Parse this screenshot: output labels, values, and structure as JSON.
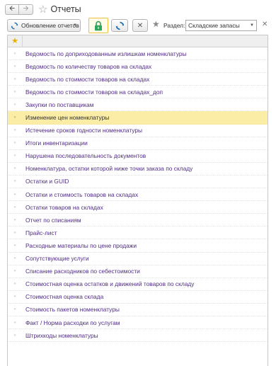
{
  "window": {
    "title": "Отчеты",
    "back_icon": "arrow-left",
    "forward_icon": "arrow-right"
  },
  "toolbar": {
    "refresh_label": "Обновление отчетов",
    "section_label": "Раздел:",
    "section_value": "Складские запасы"
  },
  "colors": {
    "link": "#502d86",
    "selected_row": "#fbeca6",
    "favorite_star": "#e7b100"
  },
  "reports": [
    "Ведомость по доприходованным излишкам номенклатуры",
    "Ведомость по количеству товаров на складах",
    "Ведомость по стоимости товаров на складах",
    "Ведомость по стоимости товаров на складах_доп",
    "Закупки по поставщикам",
    "Изменение цен номенклатуры",
    "Истечение сроков годности номенклатуры",
    "Итоги инвентаризации",
    "Нарушена последовательность документов",
    "Номенклатура, остатки которой ниже точки заказа по складу",
    "Остатки и GUID",
    "Остатки и стоимость товаров на складах",
    "Остатки товаров на складах",
    "Отчет по списаниям",
    "Прайс-лист",
    "Расходные материалы по цене продажи",
    "Сопутствующие услуги",
    "Списание расходников по себестоимости",
    "Стоимостная оценка остатков и движений товаров по складу",
    "Стоимостная оценка склада",
    "Стоимость пакетов номенклатуры",
    "Факт / Норма расходки по услугам",
    "Штрихкоды номенклатуры"
  ],
  "selected_index": 5
}
